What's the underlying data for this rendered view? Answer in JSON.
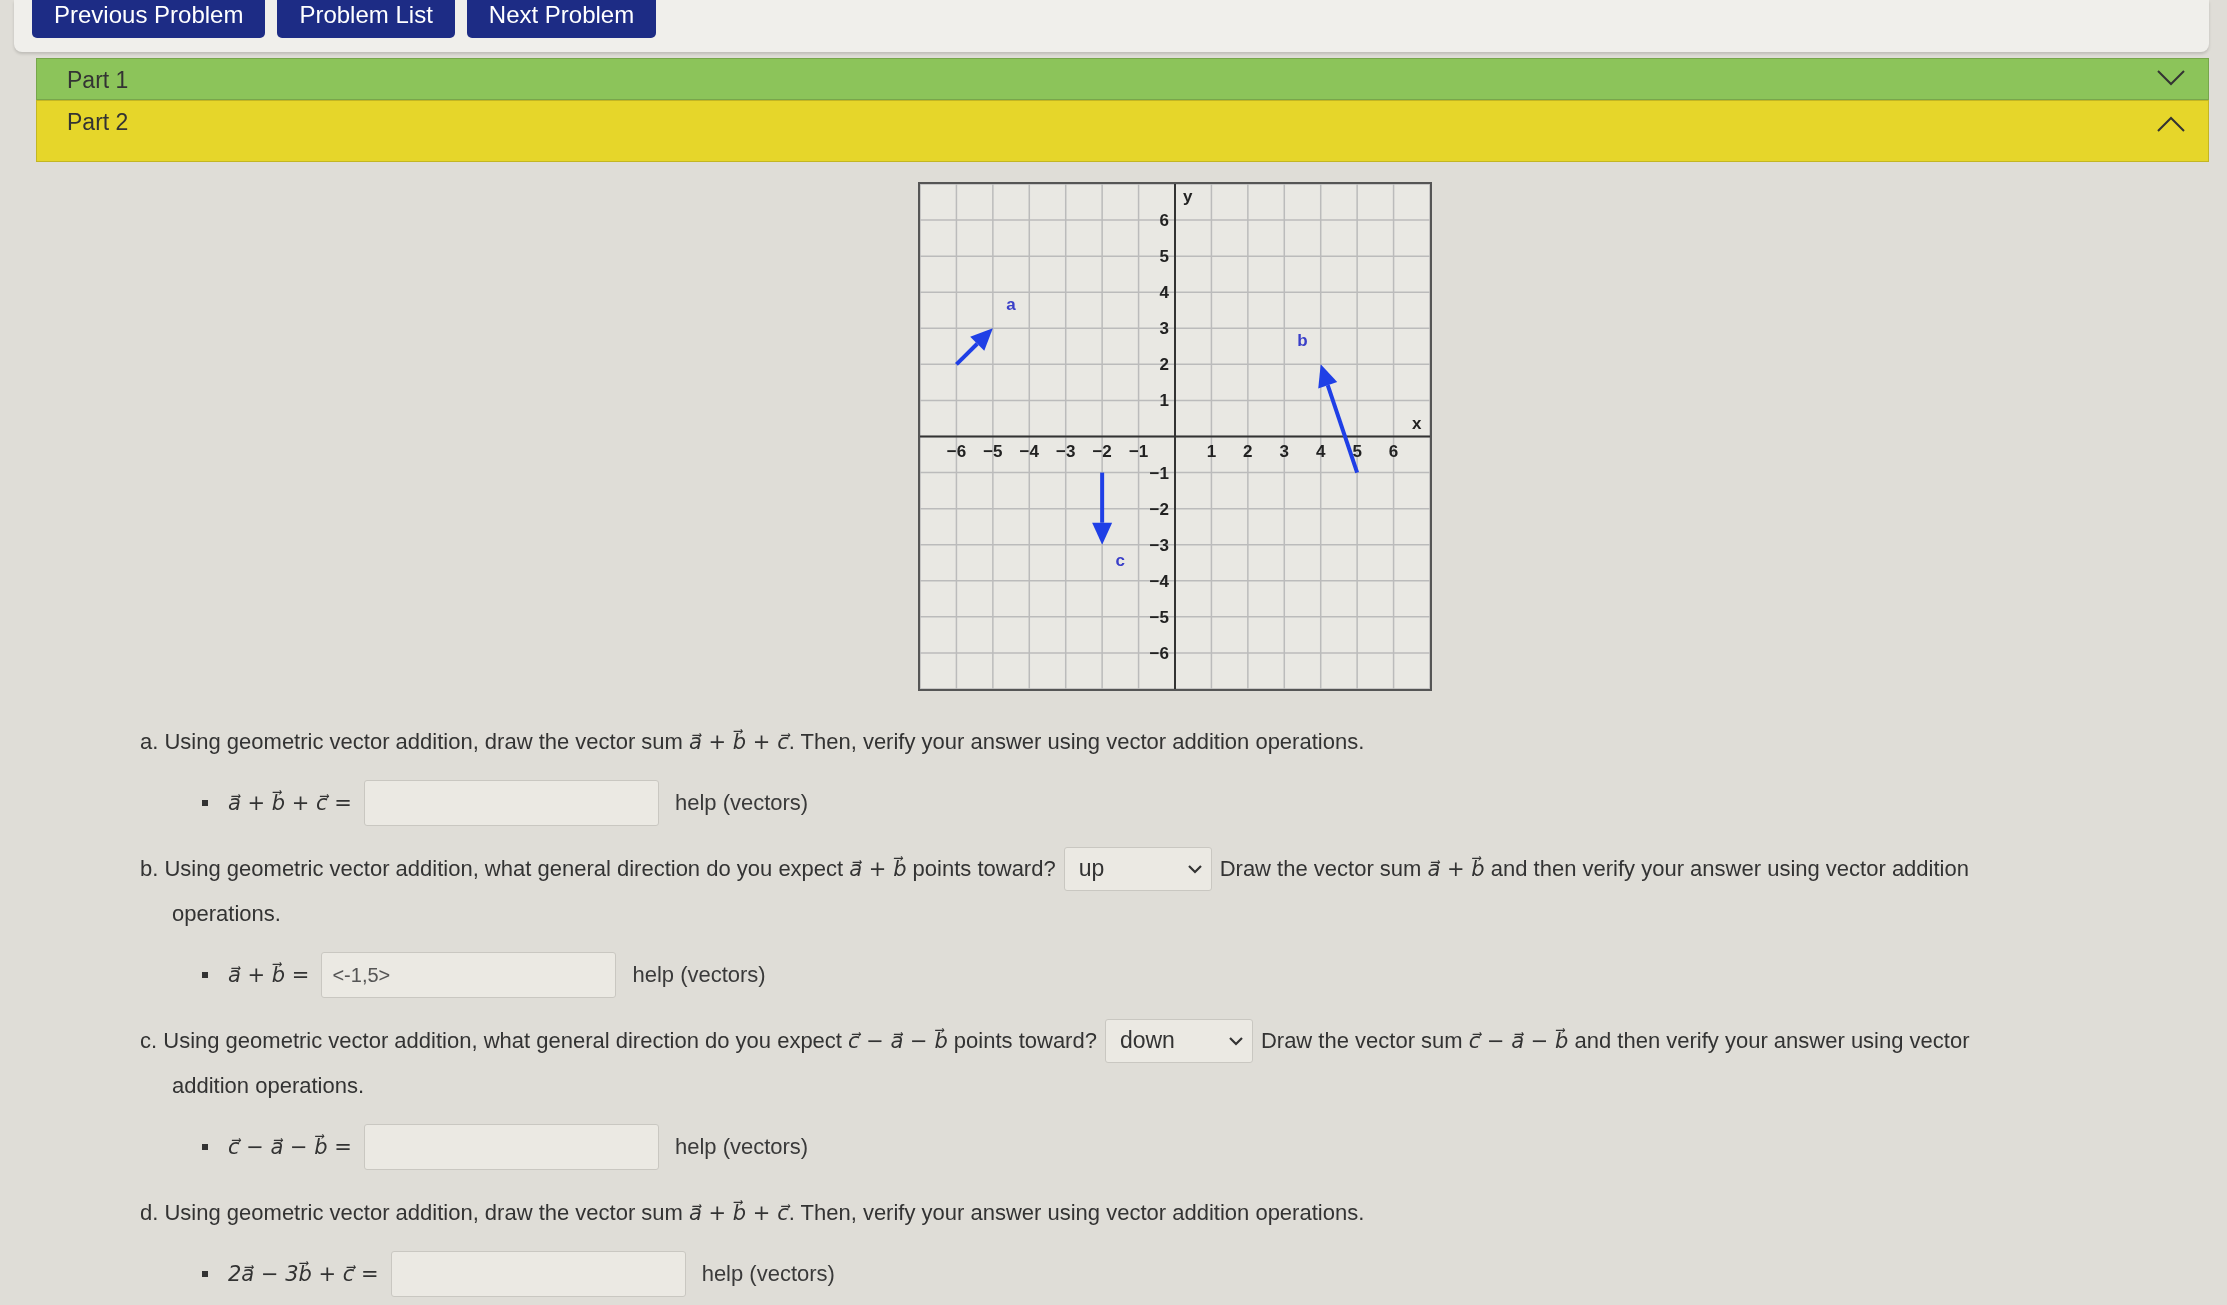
{
  "nav_buttons": [
    "Previous Problem",
    "Problem List",
    "Next Problem"
  ],
  "parts": [
    {
      "label": "Part 1",
      "expanded": false,
      "color": "#8cc45a"
    },
    {
      "label": "Part 2",
      "expanded": true,
      "color": "#e6d62a"
    }
  ],
  "graph": {
    "chart_data": {
      "type": "line",
      "grid": true,
      "xlabel": "x",
      "ylabel": "y",
      "xlim": [
        -7,
        7
      ],
      "ylim": [
        -7,
        7
      ],
      "xticks": [
        -6,
        -5,
        -4,
        -3,
        -2,
        -1,
        1,
        2,
        3,
        4,
        5,
        6
      ],
      "yticks": [
        -6,
        -5,
        -4,
        -3,
        -2,
        -1,
        1,
        2,
        3,
        4,
        5,
        6
      ],
      "annotations": [
        "a",
        "b",
        "c"
      ]
    }
  },
  "questions": [
    {
      "label": "a.",
      "lines": [
        [
          {
            "kind": "text",
            "text": "Using geometric vector addition, draw the vector sum "
          },
          {
            "kind": "math",
            "text": "a⃗ + b⃗ + c⃗"
          },
          {
            "kind": "text",
            "text": ". Then, verify your answer using vector addition operations."
          }
        ]
      ],
      "answer": {
        "expression": "a⃗ + b⃗ + c⃗ =",
        "help": "help (vectors)"
      }
    },
    {
      "label": "b.",
      "lines": [
        [
          {
            "kind": "text",
            "text": "Using geometric vector addition, what general direction do you expect "
          },
          {
            "kind": "math",
            "text": "a⃗ + b⃗"
          },
          {
            "kind": "text",
            "text": " points toward?"
          },
          {
            "kind": "select",
            "value": "up"
          },
          {
            "kind": "text",
            "text": "Draw the vector sum "
          },
          {
            "kind": "math",
            "text": "a⃗ + b⃗"
          },
          {
            "kind": "text",
            "text": " and then verify your answer using vector addition"
          }
        ],
        [
          {
            "kind": "text",
            "text": "operations."
          }
        ]
      ],
      "answer": {
        "expression": "a⃗ + b⃗ =",
        "value": "<-1,5>",
        "help": "help (vectors)"
      }
    },
    {
      "label": "c.",
      "lines": [
        [
          {
            "kind": "text",
            "text": "Using geometric vector addition, what general direction do you expect "
          },
          {
            "kind": "math",
            "text": "c⃗ − a⃗ − b⃗"
          },
          {
            "kind": "text",
            "text": " points toward?"
          },
          {
            "kind": "select",
            "value": "down"
          },
          {
            "kind": "text",
            "text": "Draw the vector sum "
          },
          {
            "kind": "math",
            "text": "c⃗ − a⃗ − b⃗"
          },
          {
            "kind": "text",
            "text": " and then verify your answer using vector"
          }
        ],
        [
          {
            "kind": "text",
            "text": "addition operations."
          }
        ]
      ],
      "answer": {
        "expression": "c⃗ − a⃗ − b⃗ =",
        "help": "help (vectors)"
      }
    },
    {
      "label": "d.",
      "lines": [
        [
          {
            "kind": "text",
            "text": "Using geometric vector addition, draw the vector sum "
          },
          {
            "kind": "math",
            "text": "a⃗ + b⃗ + c⃗"
          },
          {
            "kind": "text",
            "text": ". Then, verify your answer using vector addition operations."
          }
        ]
      ],
      "answer": {
        "expression": "2a⃗ − 3b⃗ + c⃗ =",
        "help": "help (vectors)"
      }
    }
  ]
}
